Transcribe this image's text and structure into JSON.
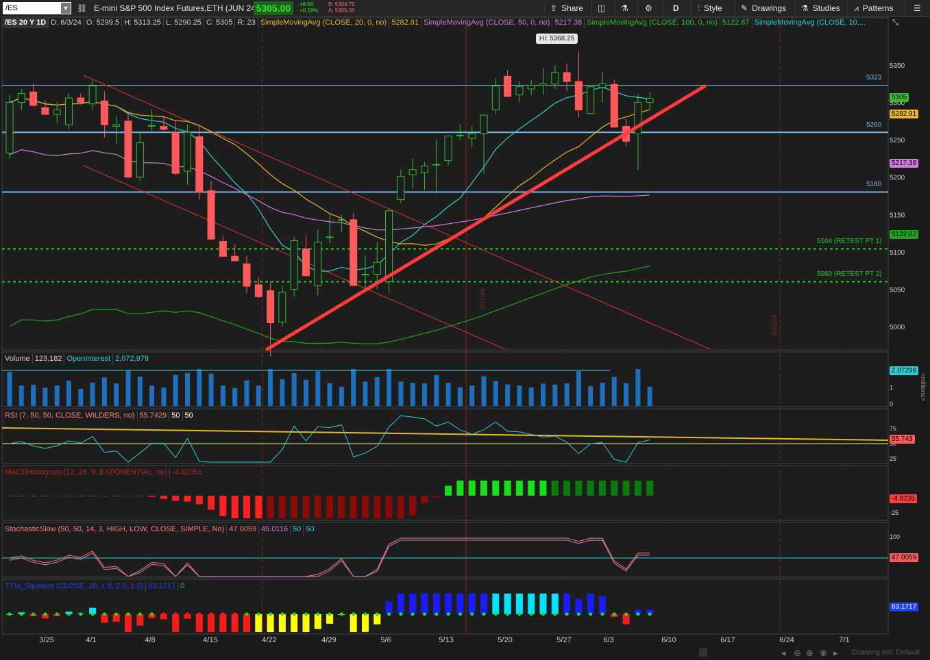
{
  "toolbar": {
    "symbol": "/ES",
    "description": "E-mini S&P 500 Index Futures,ETH (JUN 24)",
    "last": "5305.00",
    "change": "+9.50",
    "change_pct": "+0.18%",
    "bid": "B: 5304.75",
    "ask": "A: 5305.00",
    "share": "Share",
    "period": "D",
    "style": "Style",
    "drawings": "Drawings",
    "studies": "Studies",
    "patterns": "Patterns"
  },
  "header": {
    "title": "/ES 20 Y 1D",
    "date": "D: 6/3/24",
    "open": "O: 5299.5",
    "high": "H: 5313.25",
    "low": "L: 5290.25",
    "close": "C: 5305",
    "range": "R: 23",
    "sma20": "SimpleMovingAvg (CLOSE, 20, 0, no)",
    "sma20_val": "5282.91",
    "sma50": "SimpleMovingAvg (CLOSE, 50, 0, no)",
    "sma50_val": "5217.38",
    "sma100": "SimpleMovingAvg (CLOSE, 100, 0, no)",
    "sma100_val": "5122.87",
    "sma10": "SimpleMovingAvg (CLOSE, 10,..."
  },
  "colors": {
    "up": "#2fbf2f",
    "down": "#ff5a5a",
    "sma10": "#2ecfd6",
    "sma20": "#e8b62a",
    "sma50": "#d07ae0",
    "sma100": "#1fa31f",
    "level": "#6fb8e8",
    "trend": "#ff3b3b"
  },
  "price_labels": {
    "hi": "Hi: 5368.25",
    "l5323": "5323",
    "l5260": "5260",
    "l5180": "5180",
    "l5104": "5104 (RETEST PT 1)",
    "l5060": "5060 (RETEST PT 2)",
    "v1": "5/17/24",
    "v2": "6/21/24",
    "tag_last": "5305",
    "tag_sma20": "5282.91",
    "tag_sma50": "5217.38",
    "tag_sma100": "5122.87"
  },
  "volume": {
    "label": "Volume",
    "value": "123,182",
    "oi_label": "OpenInterest",
    "oi_value": "2,072,979",
    "tag": "2.07298",
    "unit": "<millions>"
  },
  "rsi": {
    "label": "RSI (7, 50, 50, CLOSE, WILDERS, no)",
    "value": "55.7429",
    "a": "50",
    "b": "50",
    "tag": "55.743"
  },
  "macd": {
    "label": "MACDHistogram (12, 26, 9, EXPONENTIAL, no)",
    "value": "-4.82351",
    "tag": "-4.8235"
  },
  "stoch": {
    "label": "StochasticSlow (50, 50, 14, 3, HIGH, LOW, CLOSE, SIMPLE, No)",
    "k": "47.0059",
    "d": "45.0116",
    "a": "50",
    "b": "50",
    "tag": "47.0059"
  },
  "squeeze": {
    "label": "TTM_Squeeze (CLOSE, 20, 1.5, 2.0, 1.0)",
    "value": "63.1717",
    "zero": "0",
    "tag": "63.1717"
  },
  "footer": {
    "drawing_set": "Drawing set: Default"
  },
  "chart_data": {
    "type": "candlestick",
    "y_ticks": [
      5000,
      5050,
      5100,
      5150,
      5200,
      5250,
      5300,
      5350
    ],
    "x_labels": [
      "3/25",
      "4/1",
      "4/8",
      "4/15",
      "4/22",
      "4/29",
      "5/6",
      "5/13",
      "5/20",
      "5/27",
      "6/3",
      "6/10",
      "6/17",
      "6/24",
      "7/1"
    ],
    "candles": [
      [
        5232,
        5310,
        5225,
        5300
      ],
      [
        5300,
        5318,
        5290,
        5312
      ],
      [
        5314,
        5325,
        5294,
        5296
      ],
      [
        5293,
        5303,
        5284,
        5284
      ],
      [
        5284,
        5300,
        5272,
        5290
      ],
      [
        5270,
        5312,
        5264,
        5306
      ],
      [
        5306,
        5312,
        5297,
        5300
      ],
      [
        5298,
        5330,
        5290,
        5322
      ],
      [
        5302,
        5315,
        5253,
        5270
      ],
      [
        5268,
        5282,
        5245,
        5270
      ],
      [
        5275,
        5288,
        5198,
        5200
      ],
      [
        5200,
        5260,
        5195,
        5246
      ],
      [
        5269,
        5290,
        5262,
        5269
      ],
      [
        5268,
        5282,
        5262,
        5264
      ],
      [
        5260,
        5276,
        5203,
        5205
      ],
      [
        5208,
        5270,
        5190,
        5260
      ],
      [
        5254,
        5270,
        5170,
        5180
      ],
      [
        5182,
        5195,
        5117,
        5117
      ],
      [
        5114,
        5122,
        5094,
        5094
      ],
      [
        5094,
        5110,
        5092,
        5088
      ],
      [
        5084,
        5095,
        5045,
        5054
      ],
      [
        5056,
        5066,
        5038,
        5040
      ],
      [
        5048,
        5060,
        4960,
        5005
      ],
      [
        5006,
        5055,
        5000,
        5046
      ],
      [
        5050,
        5120,
        5040,
        5115
      ],
      [
        5104,
        5122,
        5070,
        5068
      ],
      [
        5055,
        5130,
        5042,
        5113
      ],
      [
        5120,
        5150,
        5112,
        5120
      ],
      [
        5143,
        5150,
        5127,
        5143
      ],
      [
        5143,
        5152,
        5055,
        5055
      ],
      [
        5070,
        5095,
        5050,
        5070
      ],
      [
        5070,
        5113,
        5050,
        5086
      ],
      [
        5060,
        5156,
        5045,
        5155
      ],
      [
        5170,
        5210,
        5165,
        5201
      ],
      [
        5203,
        5225,
        5185,
        5210
      ],
      [
        5206,
        5220,
        5183,
        5215
      ],
      [
        5216,
        5250,
        5178,
        5217
      ],
      [
        5222,
        5255,
        5215,
        5255
      ],
      [
        5256,
        5271,
        5250,
        5256
      ],
      [
        5252,
        5268,
        5240,
        5258
      ],
      [
        5258,
        5272,
        5205,
        5283
      ],
      [
        5290,
        5332,
        5285,
        5322
      ],
      [
        5335,
        5343,
        5310,
        5308
      ],
      [
        5310,
        5328,
        5300,
        5321
      ],
      [
        5318,
        5330,
        5310,
        5323
      ],
      [
        5323,
        5346,
        5310,
        5325
      ],
      [
        5325,
        5350,
        5318,
        5340
      ],
      [
        5340,
        5352,
        5315,
        5328
      ],
      [
        5328,
        5368,
        5280,
        5290
      ],
      [
        5285,
        5310,
        5284,
        5321
      ],
      [
        5320,
        5340,
        5300,
        5325
      ],
      [
        5324,
        5330,
        5266,
        5267
      ],
      [
        5268,
        5278,
        5240,
        5248
      ],
      [
        5258,
        5311,
        5210,
        5300
      ],
      [
        5300,
        5313,
        5290,
        5305
      ]
    ]
  }
}
